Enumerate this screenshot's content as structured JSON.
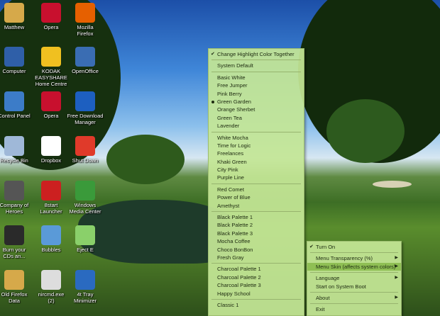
{
  "desktop_icons": [
    {
      "label": "Matthew",
      "icon": "folder-icon",
      "color": "#d6a94a"
    },
    {
      "label": "Opera",
      "icon": "opera-icon",
      "color": "#c8102e"
    },
    {
      "label": "Mozilla\nFirefox",
      "icon": "firefox-icon",
      "color": "#e66000"
    },
    {
      "label": "Computer",
      "icon": "computer-icon",
      "color": "#2f5fa8"
    },
    {
      "label": "KODAK EASYSHARE\nHome Centre",
      "icon": "kodak-icon",
      "color": "#f0c020"
    },
    {
      "label": "OpenOffice",
      "icon": "openoffice-icon",
      "color": "#3a6db3"
    },
    {
      "label": "Control Panel",
      "icon": "control-panel-icon",
      "color": "#3c7cc8"
    },
    {
      "label": "Opera",
      "icon": "opera-icon",
      "color": "#c8102e"
    },
    {
      "label": "Free Download Manager",
      "icon": "download-manager-icon",
      "color": "#1d5fc0"
    },
    {
      "label": "Recycle Bin",
      "icon": "recycle-bin-icon",
      "color": "#9fb8d8"
    },
    {
      "label": "Dropbox",
      "icon": "dropbox-icon",
      "color": "#ffffff"
    },
    {
      "label": "Shut Down",
      "icon": "power-icon",
      "color": "#e03a2a"
    },
    {
      "label": "Company of\nHeroes",
      "icon": "game-icon",
      "color": "#555555"
    },
    {
      "label": "8start\nLauncher",
      "icon": "launcher-icon",
      "color": "#cc2020"
    },
    {
      "label": "Windows\nMedia Center",
      "icon": "media-center-icon",
      "color": "#3a9a3a"
    },
    {
      "label": "Burn your\nCDs an...",
      "icon": "burn-cd-icon",
      "color": "#2a2a2a"
    },
    {
      "label": "Bubbles",
      "icon": "bubbles-icon",
      "color": "#5a9ad8"
    },
    {
      "label": "Eject E",
      "icon": "eject-icon",
      "color": "#8ad06a"
    },
    {
      "label": "Old Firefox\nData",
      "icon": "folder-icon",
      "color": "#d6a94a"
    },
    {
      "label": "nircmd.exe\n(2)",
      "icon": "program-icon",
      "color": "#dddddd"
    },
    {
      "label": "4t Tray\nMinimizer",
      "icon": "tray-minimizer-icon",
      "color": "#2a6ac0"
    }
  ],
  "skin_menu": {
    "top_item": "Change Highlight Color Together",
    "system_default": "System Default",
    "group1": [
      "Basic White",
      "Free Jumper",
      "Pink Berry",
      "Green Garden",
      "Orange Sherbet",
      "Green Tea",
      "Lavender"
    ],
    "selected": "Green Garden",
    "group2": [
      "White Mocha",
      "Time for Logic",
      "Freelances",
      "Khaki Green",
      "City Pink",
      "Purple Line"
    ],
    "group3": [
      "Red Comet",
      "Power of Blue",
      "Amethyst"
    ],
    "group4": [
      "Black Palette 1",
      "Black Palette 2",
      "Black Palette 3",
      "Mocha Coffee",
      "Choco BonBon",
      "Fresh Gray"
    ],
    "group5": [
      "Charcoal Palette 1",
      "Charcoal Palette 2",
      "Charcoal Palette 3",
      "Happy School"
    ],
    "group6": [
      "Classic 1"
    ]
  },
  "main_menu": {
    "turn_on": "Turn On",
    "transparency": "Menu Transparency (%)",
    "skin": "Menu Skin (affects system colors)",
    "language": "Language",
    "start_on_boot": "Start on System Boot",
    "about": "About",
    "exit": "Exit"
  }
}
